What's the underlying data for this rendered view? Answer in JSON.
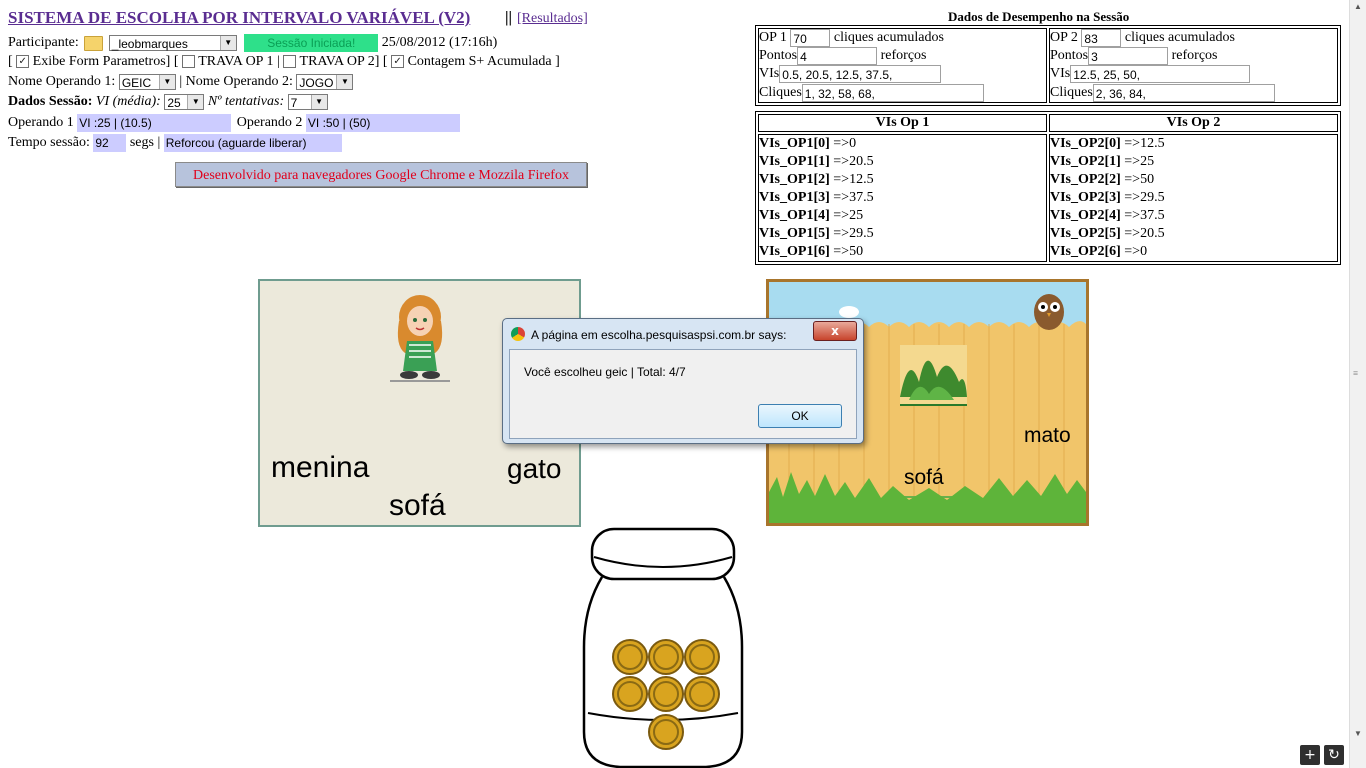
{
  "header": {
    "title": "SISTEMA DE ESCOLHA POR INTERVALO VARIÁVEL (V2)",
    "separator": "||",
    "results_link": "[Resultados]"
  },
  "participant": {
    "label": "Participante:",
    "value": "_leobmarques",
    "session_status": "Sessão Iniciada!",
    "datetime": "25/08/2012 (17:16h)"
  },
  "options": {
    "show_form_label": "Exibe Form Parametros]",
    "show_form_checked": true,
    "lock_op1_label": "TRAVA OP 1 |",
    "lock_op1_checked": false,
    "lock_op2_label": "TRAVA OP 2]",
    "lock_op2_checked": false,
    "count_label": "Contagem S+ Acumulada ]",
    "count_checked": true
  },
  "operands": {
    "op1_name_label": "Nome Operando 1:",
    "op1_name_value": "GEIC",
    "sep_label": "| Nome Operando 2:",
    "op2_name_value": "JOGO"
  },
  "session_data": {
    "label": "Dados Sessão:",
    "vi_label": "VI (média):",
    "vi_value": "25",
    "attempts_label": "Nº tentativas:",
    "attempts_value": "7"
  },
  "operand_status": {
    "op1_label": "Operando 1",
    "op1_value": "VI :25 | (10.5)",
    "op2_label": "Operando 2",
    "op2_value": "VI :50 | (50)"
  },
  "session_time": {
    "label": "Tempo sessão:",
    "value": "92",
    "unit": "segs |",
    "status": "Reforcou (aguarde liberar)"
  },
  "dev_note": "Desenvolvido para navegadores Google Chrome e Mozzila Firefox",
  "performance": {
    "heading": "Dados de Desempenho na Sessão",
    "op1": {
      "label": "OP 1",
      "clicks": "70",
      "clicks_label": "cliques acumulados",
      "points_label": "Pontos",
      "points": "4",
      "reinf_label": "reforços",
      "vis_label": "VIs",
      "vis": "0.5, 20.5, 12.5, 37.5,",
      "cliques_label": "Cliques",
      "cliques": "1, 32, 58, 68,"
    },
    "op2": {
      "label": "OP 2",
      "clicks": "83",
      "clicks_label": "cliques acumulados",
      "points_label": "Pontos",
      "points": "3",
      "reinf_label": "reforços",
      "vis_label": "VIs",
      "vis": "12.5, 25, 50,",
      "cliques_label": "Cliques",
      "cliques": "2, 36, 84,"
    }
  },
  "vis_table": {
    "op1_header": "VIs Op 1",
    "op2_header": "VIs Op 2",
    "op1_rows": [
      {
        "key": "VIs_OP1[0]",
        "val": "=>0"
      },
      {
        "key": "VIs_OP1[1]",
        "val": "=>20.5"
      },
      {
        "key": "VIs_OP1[2]",
        "val": "=>12.5"
      },
      {
        "key": "VIs_OP1[3]",
        "val": "=>37.5"
      },
      {
        "key": "VIs_OP1[4]",
        "val": "=>25"
      },
      {
        "key": "VIs_OP1[5]",
        "val": "=>29.5"
      },
      {
        "key": "VIs_OP1[6]",
        "val": "=>50"
      }
    ],
    "op2_rows": [
      {
        "key": "VIs_OP2[0]",
        "val": "=>12.5"
      },
      {
        "key": "VIs_OP2[1]",
        "val": "=>25"
      },
      {
        "key": "VIs_OP2[2]",
        "val": "=>50"
      },
      {
        "key": "VIs_OP2[3]",
        "val": "=>29.5"
      },
      {
        "key": "VIs_OP2[4]",
        "val": "=>37.5"
      },
      {
        "key": "VIs_OP2[5]",
        "val": "=>20.5"
      },
      {
        "key": "VIs_OP2[6]",
        "val": "=>0"
      }
    ]
  },
  "cards": {
    "left_words": [
      "menina",
      "gato",
      "sofá"
    ],
    "right_words": [
      "mato",
      "sofá"
    ]
  },
  "dialog": {
    "title": "A página em escolha.pesquisaspsi.com.br says:",
    "message": "Você escolheu geic | Total: 4/7",
    "ok_label": "OK",
    "close_label": "x"
  },
  "jar": {
    "coins": 7
  },
  "colors": {
    "title": "#5a2d91",
    "field_bg": "#ccccff",
    "status_green": "#2ee08a",
    "dev_text": "#e0001b"
  }
}
